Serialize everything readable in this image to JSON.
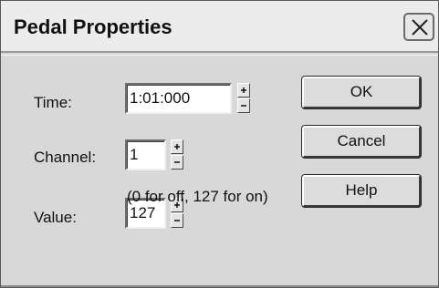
{
  "dialog": {
    "title": "Pedal Properties",
    "close_icon": "close-icon"
  },
  "fields": {
    "time": {
      "label": "Time:",
      "value": "1:01:000"
    },
    "channel": {
      "label": "Channel:",
      "value": "1"
    },
    "value": {
      "label": "Value:",
      "value": "127"
    }
  },
  "hint": "(0 for off, 127 for on)",
  "buttons": {
    "ok": "OK",
    "cancel": "Cancel",
    "help": "Help"
  },
  "icons": {
    "spin_up": "spin-up-icon",
    "spin_down": "spin-down-icon"
  }
}
